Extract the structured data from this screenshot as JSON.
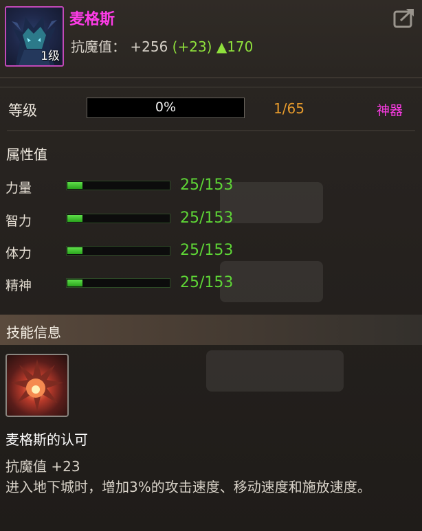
{
  "item": {
    "name": "麦格斯",
    "level_badge": "1级",
    "stat_label": "抗魔值：",
    "stat_value": "+256",
    "stat_bonus": "(+23)",
    "stat_increase": "▲170"
  },
  "grade": {
    "label": "等级",
    "progress_text": "0%",
    "progress_fraction": 0,
    "exp_text": "1/65",
    "rarity": "神器"
  },
  "attributes": {
    "title": "属性值",
    "items": [
      {
        "name": "力量",
        "value": "25/153",
        "fraction": 0.163
      },
      {
        "name": "智力",
        "value": "25/153",
        "fraction": 0.163
      },
      {
        "name": "体力",
        "value": "25/153",
        "fraction": 0.163
      },
      {
        "name": "精神",
        "value": "25/153",
        "fraction": 0.163
      }
    ]
  },
  "skill": {
    "section_title": "技能信息",
    "name": "麦格斯的认可",
    "stat": "抗魔值 +23",
    "description": "进入地下城时，增加3%的攻击速度、移动速度和施放速度。"
  },
  "icons": {
    "portrait": "dragon-portrait-icon",
    "share": "share-icon",
    "skill": "skill-burst-icon"
  },
  "colors": {
    "name": "#ff3ce8",
    "bonus": "#8fe03c",
    "exp": "#e69a2c",
    "rarity": "#ff3ce8",
    "attr_value": "#5ed636"
  }
}
